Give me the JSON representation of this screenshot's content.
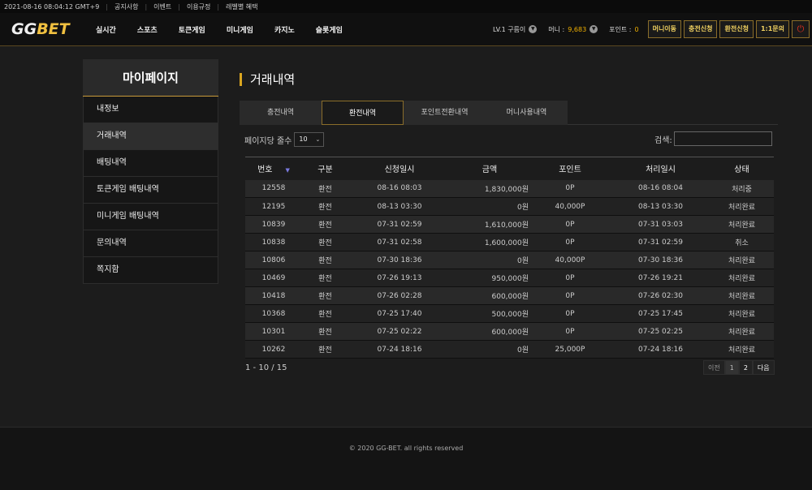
{
  "topbar": {
    "datetime": "2021-08-16 08:04:12 GMT+9",
    "links": [
      "공지사항",
      "이벤트",
      "이용규정",
      "레벨별 혜택"
    ]
  },
  "header": {
    "logo_main": "GG",
    "logo_sub": "BET",
    "nav": [
      "실시간",
      "스포츠",
      "토큰게임",
      "미니게임",
      "카지노",
      "슬롯게임"
    ],
    "level": "LV.1 구름이",
    "money_label": "머니 :",
    "money_value": "9,683",
    "point_label": "포인트 :",
    "point_value": "0",
    "buttons": [
      "머니이동",
      "충전신청",
      "환전신청",
      "1:1문의"
    ],
    "power_icon": "⏻"
  },
  "sidebar": {
    "title": "마이페이지",
    "items": [
      "내정보",
      "거래내역",
      "배팅내역",
      "토큰게임 배팅내역",
      "미니게임 배팅내역",
      "문의내역",
      "쪽지함"
    ],
    "active_index": 1
  },
  "main": {
    "title": "거래내역",
    "tabs": [
      "충전내역",
      "환전내역",
      "포인트전환내역",
      "머니사용내역"
    ],
    "active_tab": 1,
    "perpage_label": "페이지당 줄수",
    "perpage_value": "10",
    "search_label": "검색:",
    "search_value": "",
    "columns": [
      "번호",
      "구분",
      "신청일시",
      "금액",
      "포인트",
      "처리일시",
      "상태"
    ],
    "rows": [
      [
        "12558",
        "환전",
        "08-16 08:03",
        "1,830,000원",
        "0P",
        "08-16 08:04",
        "처리중"
      ],
      [
        "12195",
        "환전",
        "08-13 03:30",
        "0원",
        "40,000P",
        "08-13 03:30",
        "처리완료"
      ],
      [
        "10839",
        "환전",
        "07-31 02:59",
        "1,610,000원",
        "0P",
        "07-31 03:03",
        "처리완료"
      ],
      [
        "10838",
        "환전",
        "07-31 02:58",
        "1,600,000원",
        "0P",
        "07-31 02:59",
        "취소"
      ],
      [
        "10806",
        "환전",
        "07-30 18:36",
        "0원",
        "40,000P",
        "07-30 18:36",
        "처리완료"
      ],
      [
        "10469",
        "환전",
        "07-26 19:13",
        "950,000원",
        "0P",
        "07-26 19:21",
        "처리완료"
      ],
      [
        "10418",
        "환전",
        "07-26 02:28",
        "600,000원",
        "0P",
        "07-26 02:30",
        "처리완료"
      ],
      [
        "10368",
        "환전",
        "07-25 17:40",
        "500,000원",
        "0P",
        "07-25 17:45",
        "처리완료"
      ],
      [
        "10301",
        "환전",
        "07-25 02:22",
        "600,000원",
        "0P",
        "07-25 02:25",
        "처리완료"
      ],
      [
        "10262",
        "환전",
        "07-24 18:16",
        "0원",
        "25,000P",
        "07-24 18:16",
        "처리완료"
      ]
    ],
    "page_info": "1 - 10 / 15",
    "pager": [
      "이전",
      "1",
      "2",
      "다음"
    ]
  },
  "footer": {
    "copyright": "© 2020 GG-BET. all rights reserved"
  }
}
